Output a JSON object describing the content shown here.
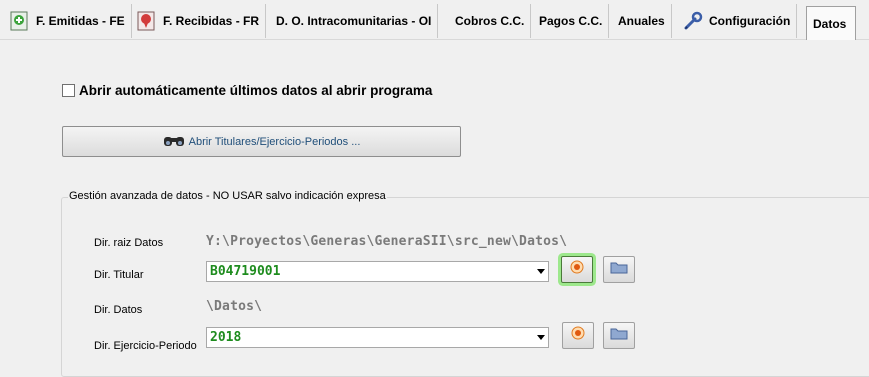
{
  "tabs": [
    {
      "label": "F. Emitidas - FE",
      "icon": "issued-invoice-icon"
    },
    {
      "label": "F. Recibidas - FR",
      "icon": "received-invoice-icon"
    },
    {
      "label": "D. O. Intracomunitarias - OI"
    },
    {
      "label": "Cobros C.C."
    },
    {
      "label": "Pagos C.C."
    },
    {
      "label": "Anuales"
    },
    {
      "label": "Configuración",
      "icon": "configuration-icon"
    },
    {
      "label": "Datos",
      "active": true
    }
  ],
  "datos": {
    "auto_open_label": "Abrir automáticamente últimos datos al abrir programa",
    "auto_open_checked": false,
    "open_button_label": "Abrir Titulares/Ejercicio-Periodos ...",
    "advanced_group_title": "Gestión avanzada de datos - NO USAR salvo indicación expresa",
    "dir_raiz_label": "Dir. raiz Datos",
    "dir_raiz_value": "Y:\\Proyectos\\Generas\\GeneraSII\\src_new\\Datos\\",
    "dir_titular_label": "Dir. Titular",
    "dir_titular_value": "B04719001",
    "dir_datos_label": "Dir. Datos",
    "dir_datos_value": "\\Datos\\",
    "dir_ejercicio_label": "Dir. Ejercicio-Periodo",
    "dir_ejercicio_value": "2018"
  },
  "colors": {
    "combo_value": "#1e8c1e",
    "path_value": "#7a7a7a",
    "button_text": "#1f4e79",
    "focus_ring": "#9de88c"
  }
}
